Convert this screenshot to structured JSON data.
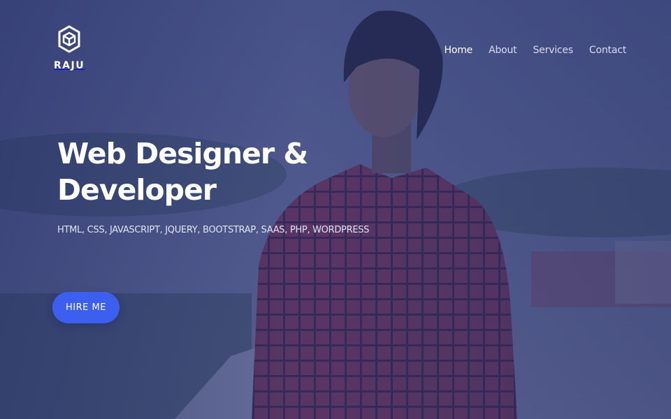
{
  "brand": {
    "name": "RAJU",
    "logo_icon": "hexagon-cube-logo"
  },
  "nav": {
    "items": [
      {
        "label": "Home",
        "active": true
      },
      {
        "label": "About",
        "active": false
      },
      {
        "label": "Services",
        "active": false
      },
      {
        "label": "Contact",
        "active": false
      }
    ]
  },
  "hero": {
    "title_line1": "Web Designer &",
    "title_line2": "Developer",
    "skills": "HTML, CSS, JAVASCRIPT, JQUERY, BOOTSTRAP, SAAS, PHP, WORDPRESS",
    "cta_label": "HIRE ME"
  },
  "colors": {
    "overlay": "#2a3472",
    "accent": "#3c5ff0",
    "text": "#ffffff"
  }
}
